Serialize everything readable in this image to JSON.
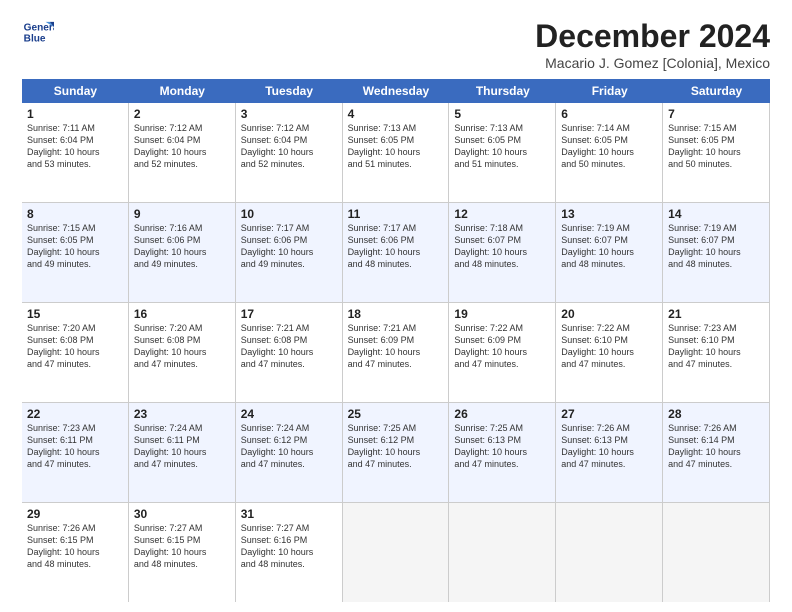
{
  "logo": {
    "line1": "General",
    "line2": "Blue"
  },
  "title": "December 2024",
  "location": "Macario J. Gomez [Colonia], Mexico",
  "days_of_week": [
    "Sunday",
    "Monday",
    "Tuesday",
    "Wednesday",
    "Thursday",
    "Friday",
    "Saturday"
  ],
  "weeks": [
    [
      {
        "day": "1",
        "info": "Sunrise: 7:11 AM\nSunset: 6:04 PM\nDaylight: 10 hours\nand 53 minutes.",
        "empty": false,
        "alt": false
      },
      {
        "day": "2",
        "info": "Sunrise: 7:12 AM\nSunset: 6:04 PM\nDaylight: 10 hours\nand 52 minutes.",
        "empty": false,
        "alt": false
      },
      {
        "day": "3",
        "info": "Sunrise: 7:12 AM\nSunset: 6:04 PM\nDaylight: 10 hours\nand 52 minutes.",
        "empty": false,
        "alt": false
      },
      {
        "day": "4",
        "info": "Sunrise: 7:13 AM\nSunset: 6:05 PM\nDaylight: 10 hours\nand 51 minutes.",
        "empty": false,
        "alt": false
      },
      {
        "day": "5",
        "info": "Sunrise: 7:13 AM\nSunset: 6:05 PM\nDaylight: 10 hours\nand 51 minutes.",
        "empty": false,
        "alt": false
      },
      {
        "day": "6",
        "info": "Sunrise: 7:14 AM\nSunset: 6:05 PM\nDaylight: 10 hours\nand 50 minutes.",
        "empty": false,
        "alt": false
      },
      {
        "day": "7",
        "info": "Sunrise: 7:15 AM\nSunset: 6:05 PM\nDaylight: 10 hours\nand 50 minutes.",
        "empty": false,
        "alt": false
      }
    ],
    [
      {
        "day": "8",
        "info": "Sunrise: 7:15 AM\nSunset: 6:05 PM\nDaylight: 10 hours\nand 49 minutes.",
        "empty": false,
        "alt": true
      },
      {
        "day": "9",
        "info": "Sunrise: 7:16 AM\nSunset: 6:06 PM\nDaylight: 10 hours\nand 49 minutes.",
        "empty": false,
        "alt": true
      },
      {
        "day": "10",
        "info": "Sunrise: 7:17 AM\nSunset: 6:06 PM\nDaylight: 10 hours\nand 49 minutes.",
        "empty": false,
        "alt": true
      },
      {
        "day": "11",
        "info": "Sunrise: 7:17 AM\nSunset: 6:06 PM\nDaylight: 10 hours\nand 48 minutes.",
        "empty": false,
        "alt": true
      },
      {
        "day": "12",
        "info": "Sunrise: 7:18 AM\nSunset: 6:07 PM\nDaylight: 10 hours\nand 48 minutes.",
        "empty": false,
        "alt": true
      },
      {
        "day": "13",
        "info": "Sunrise: 7:19 AM\nSunset: 6:07 PM\nDaylight: 10 hours\nand 48 minutes.",
        "empty": false,
        "alt": true
      },
      {
        "day": "14",
        "info": "Sunrise: 7:19 AM\nSunset: 6:07 PM\nDaylight: 10 hours\nand 48 minutes.",
        "empty": false,
        "alt": true
      }
    ],
    [
      {
        "day": "15",
        "info": "Sunrise: 7:20 AM\nSunset: 6:08 PM\nDaylight: 10 hours\nand 47 minutes.",
        "empty": false,
        "alt": false
      },
      {
        "day": "16",
        "info": "Sunrise: 7:20 AM\nSunset: 6:08 PM\nDaylight: 10 hours\nand 47 minutes.",
        "empty": false,
        "alt": false
      },
      {
        "day": "17",
        "info": "Sunrise: 7:21 AM\nSunset: 6:08 PM\nDaylight: 10 hours\nand 47 minutes.",
        "empty": false,
        "alt": false
      },
      {
        "day": "18",
        "info": "Sunrise: 7:21 AM\nSunset: 6:09 PM\nDaylight: 10 hours\nand 47 minutes.",
        "empty": false,
        "alt": false
      },
      {
        "day": "19",
        "info": "Sunrise: 7:22 AM\nSunset: 6:09 PM\nDaylight: 10 hours\nand 47 minutes.",
        "empty": false,
        "alt": false
      },
      {
        "day": "20",
        "info": "Sunrise: 7:22 AM\nSunset: 6:10 PM\nDaylight: 10 hours\nand 47 minutes.",
        "empty": false,
        "alt": false
      },
      {
        "day": "21",
        "info": "Sunrise: 7:23 AM\nSunset: 6:10 PM\nDaylight: 10 hours\nand 47 minutes.",
        "empty": false,
        "alt": false
      }
    ],
    [
      {
        "day": "22",
        "info": "Sunrise: 7:23 AM\nSunset: 6:11 PM\nDaylight: 10 hours\nand 47 minutes.",
        "empty": false,
        "alt": true
      },
      {
        "day": "23",
        "info": "Sunrise: 7:24 AM\nSunset: 6:11 PM\nDaylight: 10 hours\nand 47 minutes.",
        "empty": false,
        "alt": true
      },
      {
        "day": "24",
        "info": "Sunrise: 7:24 AM\nSunset: 6:12 PM\nDaylight: 10 hours\nand 47 minutes.",
        "empty": false,
        "alt": true
      },
      {
        "day": "25",
        "info": "Sunrise: 7:25 AM\nSunset: 6:12 PM\nDaylight: 10 hours\nand 47 minutes.",
        "empty": false,
        "alt": true
      },
      {
        "day": "26",
        "info": "Sunrise: 7:25 AM\nSunset: 6:13 PM\nDaylight: 10 hours\nand 47 minutes.",
        "empty": false,
        "alt": true
      },
      {
        "day": "27",
        "info": "Sunrise: 7:26 AM\nSunset: 6:13 PM\nDaylight: 10 hours\nand 47 minutes.",
        "empty": false,
        "alt": true
      },
      {
        "day": "28",
        "info": "Sunrise: 7:26 AM\nSunset: 6:14 PM\nDaylight: 10 hours\nand 47 minutes.",
        "empty": false,
        "alt": true
      }
    ],
    [
      {
        "day": "29",
        "info": "Sunrise: 7:26 AM\nSunset: 6:15 PM\nDaylight: 10 hours\nand 48 minutes.",
        "empty": false,
        "alt": false
      },
      {
        "day": "30",
        "info": "Sunrise: 7:27 AM\nSunset: 6:15 PM\nDaylight: 10 hours\nand 48 minutes.",
        "empty": false,
        "alt": false
      },
      {
        "day": "31",
        "info": "Sunrise: 7:27 AM\nSunset: 6:16 PM\nDaylight: 10 hours\nand 48 minutes.",
        "empty": false,
        "alt": false
      },
      {
        "day": "",
        "info": "",
        "empty": true,
        "alt": false
      },
      {
        "day": "",
        "info": "",
        "empty": true,
        "alt": false
      },
      {
        "day": "",
        "info": "",
        "empty": true,
        "alt": false
      },
      {
        "day": "",
        "info": "",
        "empty": true,
        "alt": false
      }
    ]
  ]
}
